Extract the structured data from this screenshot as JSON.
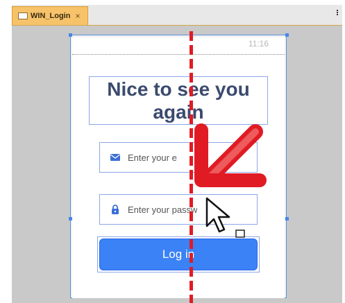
{
  "tab": {
    "label": "WIN_Login",
    "close": "×"
  },
  "status": {
    "time": "11:16"
  },
  "login": {
    "title": "Nice to see you again",
    "email_placeholder": "Enter your e",
    "password_placeholder": "Enter your passw",
    "button_label": "Log in"
  },
  "icons": {
    "tab": "document-icon",
    "email": "envelope-icon",
    "password": "lock-icon",
    "overlay": "arrow-down-left-icon",
    "cursor": "mouse-pointer-icon",
    "corner": "more-icon"
  },
  "colors": {
    "tab_bg": "#f6c36b",
    "selection": "#4a86e8",
    "guide": "#e01b24",
    "button": "#3b82f6",
    "title": "#3b4a6e"
  }
}
